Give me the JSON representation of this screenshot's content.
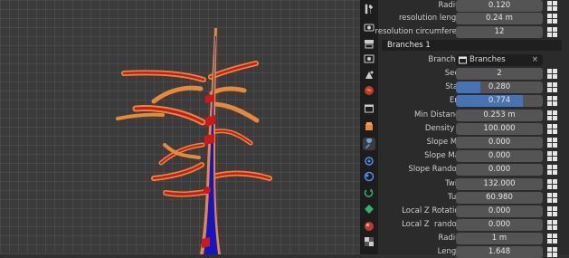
{
  "colors": {
    "accent": "#4772b3",
    "tree_trunk": "#1414c8",
    "tree_branch_core": "#cc1a1a",
    "tree_branch_edge": "#e8893a"
  },
  "sidebar_tabs": [
    {
      "icon": "tool-icon",
      "active": false
    },
    {
      "icon": "render-icon",
      "active": false
    },
    {
      "icon": "output-icon",
      "active": false
    },
    {
      "icon": "view-layer-icon",
      "active": false
    },
    {
      "icon": "scene-icon",
      "active": false
    },
    {
      "icon": "world-icon",
      "active": false
    },
    {
      "icon": "collection-icon",
      "active": false
    },
    {
      "icon": "object-icon",
      "active": false
    },
    {
      "icon": "modifier-wrench-icon",
      "active": true
    },
    {
      "icon": "particles-icon",
      "active": false
    },
    {
      "icon": "physics-icon",
      "active": false
    },
    {
      "icon": "constraints-icon",
      "active": false
    },
    {
      "icon": "data-icon",
      "active": false
    },
    {
      "icon": "material-icon",
      "active": false
    },
    {
      "icon": "texture-icon",
      "active": false
    }
  ],
  "properties": {
    "radius_top": {
      "label": "Radius",
      "value": "0.120"
    },
    "resolution_length": {
      "label": "resolution length",
      "value": "0.24 m"
    },
    "resolution_circumference": {
      "label": "resolution circumfere...",
      "value": "12"
    },
    "section_header": "Branches 1",
    "branches": {
      "label": "Branches",
      "value": "Branches",
      "clear": "×"
    },
    "seed": {
      "label": "Seed",
      "value": "2"
    },
    "start": {
      "label": "Start",
      "value": "0.280",
      "fraction": 0.28
    },
    "end": {
      "label": "End",
      "value": "0.774",
      "fraction": 0.774
    },
    "min_distance": {
      "label": "Min Distance",
      "value": "0.253 m"
    },
    "density": {
      "label": "Density %",
      "value": "100.000"
    },
    "slope_min": {
      "label": "Slope Min",
      "value": "0.000"
    },
    "slope_max": {
      "label": "Slope Max",
      "value": "0.000"
    },
    "slope_random": {
      "label": "Slope Random",
      "value": "0.000"
    },
    "twist": {
      "label": "Twist",
      "value": "132.000"
    },
    "turn": {
      "label": "Turn",
      "value": "60.980"
    },
    "local_z_rotation": {
      "label": "Local Z Rotation",
      "value": "0.000"
    },
    "local_z_random": {
      "label": "Local Z  random",
      "value": "0.000"
    },
    "radius": {
      "label": "Radius",
      "value": "1 m"
    },
    "length": {
      "label": "Length",
      "value": "1.648"
    }
  }
}
